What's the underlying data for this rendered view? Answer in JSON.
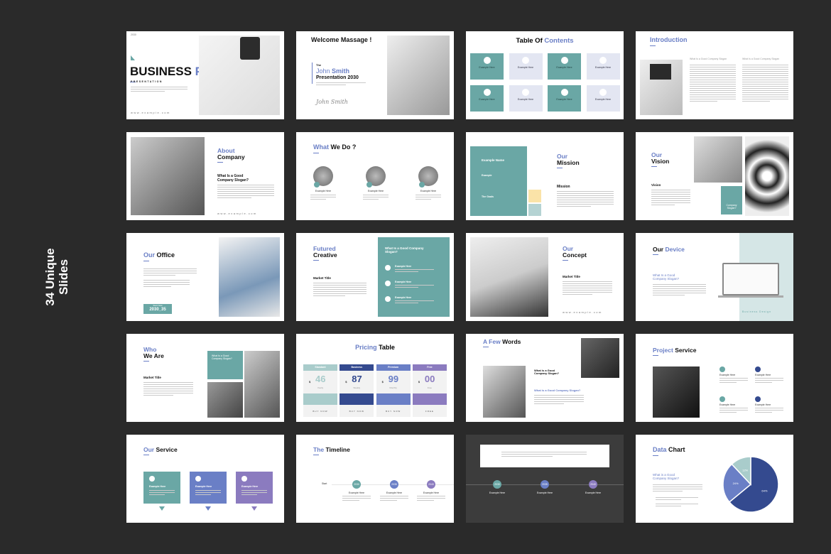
{
  "promo": {
    "line1": "34 Unique",
    "line2": "Slides"
  },
  "colors": {
    "background": "#2a2a2a",
    "teal": "#6aa7a5",
    "navy": "#344a8f",
    "periwinkle": "#6a7fc6",
    "purple": "#8b7bbf",
    "lavender": "#e3e6f2",
    "accent_text": "#6a7fc6"
  },
  "slides": [
    {
      "year": "2030",
      "title_dark": "BUSINESS",
      "title_accent": "PLAN",
      "subtitle": "PRESENTATION",
      "url": "www.example.com"
    },
    {
      "title": "Welcome Massage !",
      "the": "The",
      "name_light": "John",
      "name_bold": "Smith",
      "line": "Presentation 2030",
      "signature": "John Smith"
    },
    {
      "title_dark": "Table Of",
      "title_accent": "Contents",
      "items": [
        "Example Here",
        "Example Here",
        "Example Here",
        "Example Here",
        "Example Here",
        "Example Here",
        "Example Here",
        "Example Here"
      ]
    },
    {
      "title_accent": "Introduction",
      "col1": "What Is a Good Company Slogan",
      "col2": "What Is a Good Company Slogan"
    },
    {
      "title_accent": "About",
      "title_dark": "Company",
      "heading": "What Is a Good Company Slogan?",
      "url": "www.example.com"
    },
    {
      "title_accent": "What",
      "title_dark": "We Do ?",
      "items": [
        "Example Here",
        "Example Here",
        "Example Here"
      ]
    },
    {
      "title_accent": "Our",
      "title_dark": "Mission",
      "panel_title": "Example Name",
      "panel_item1": "Example",
      "panel_item2": "The Goals",
      "label": "Mission"
    },
    {
      "title_accent": "Our",
      "title_dark": "Vision",
      "label": "Vision",
      "badge": "Company Slogan?"
    },
    {
      "title_accent": "Our",
      "title_dark": "Office",
      "button_small": "Start Now",
      "button": "2030_35"
    },
    {
      "title_accent": "Futured",
      "title_dark": "Creative",
      "label": "Market Title",
      "panel_title": "What Is a Good Company Slogan?",
      "items": [
        "Example Here",
        "Example Here",
        "Example Here"
      ]
    },
    {
      "title_accent": "Our",
      "title_dark": "Concept",
      "label": "Market Title",
      "url": "www.example.com"
    },
    {
      "title_dark_first": "Our",
      "title_dark": "Device",
      "heading": "What Is a Good Company Slogan?",
      "caption": "Business Design"
    },
    {
      "title_accent": "Who",
      "title_dark": "We Are",
      "label": "Market Title",
      "box": "What Is a Good Company Slogan?"
    },
    {
      "title_accent": "Pricing",
      "title_dark": "Table",
      "plans": [
        {
          "name": "Standard",
          "price": "46",
          "period": "Yearly",
          "button": "BUY NOW",
          "color": "#a9cccb"
        },
        {
          "name": "Business",
          "price": "87",
          "period": "Weekly",
          "button": "BUY NOW",
          "color": "#344a8f"
        },
        {
          "name": "Premium",
          "price": "99",
          "period": "Monthly",
          "button": "BUY NOW",
          "color": "#6a7fc6"
        },
        {
          "name": "Free",
          "price": "00",
          "period": "Free",
          "button": "FREE",
          "color": "#8b7bbf"
        }
      ],
      "currency": "$"
    },
    {
      "title_accent": "A Few",
      "title_dark": "Words",
      "heading": "What is a Good Company Slogan?",
      "heading2": "What is a Good Company Slogan?"
    },
    {
      "title_accent": "Project",
      "title_dark": "Service",
      "items": [
        "Example Here",
        "Example Here",
        "Example Here",
        "Example Here"
      ]
    },
    {
      "title_accent": "Our",
      "title_dark": "Service",
      "items": [
        "Example Here",
        "Example Here",
        "Example Here"
      ]
    },
    {
      "title_accent": "The",
      "title_dark": "Timeline",
      "start": "Start",
      "years": [
        "2030",
        "2035",
        "2040"
      ],
      "items": [
        "Example Here",
        "Example Here",
        "Example Here"
      ]
    },
    {
      "years": [
        "2030",
        "2035",
        "2040"
      ],
      "items": [
        "Example Here",
        "Example Here",
        "Example Here"
      ]
    },
    {
      "title_accent": "Data",
      "title_dark": "Chart",
      "heading": "What is a Good Company Slogan?"
    }
  ],
  "chart_data": {
    "type": "pie",
    "values": [
      64,
      24,
      12
    ],
    "labels": [
      "64%",
      "24%",
      "12%"
    ],
    "colors": [
      "#344a8f",
      "#6a7fc6",
      "#a9cccb"
    ]
  }
}
